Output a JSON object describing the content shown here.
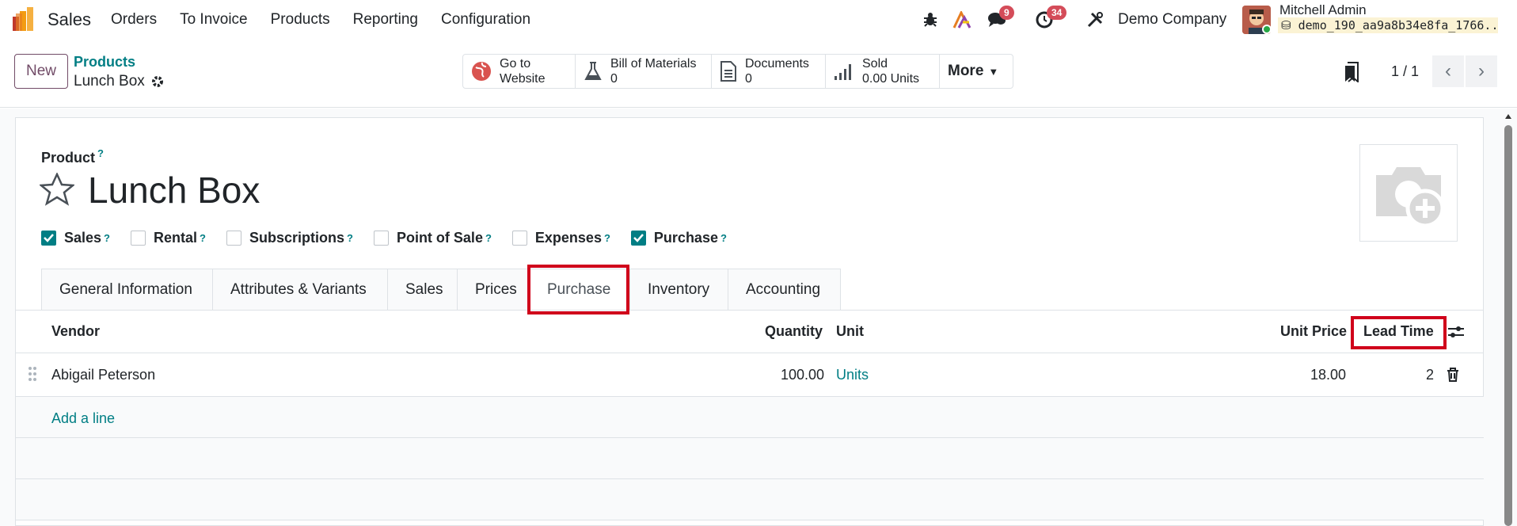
{
  "nav": {
    "app_name": "Sales",
    "menu": [
      "Orders",
      "To Invoice",
      "Products",
      "Reporting",
      "Configuration"
    ],
    "messages_count": "9",
    "activities_count": "34",
    "company": "Demo Company",
    "user_name": "Mitchell Admin",
    "database": "demo_190_aa9a8b34e8fa_1766..."
  },
  "control": {
    "new_label": "New",
    "breadcrumb": "Products",
    "record_name": "Lunch Box",
    "stats": {
      "website_line1": "Go to",
      "website_line2": "Website",
      "bom_label": "Bill of Materials",
      "bom_value": "0",
      "docs_label": "Documents",
      "docs_value": "0",
      "sold_label": "Sold",
      "sold_value": "0.00 Units",
      "more_label": "More"
    },
    "pager": "1 / 1"
  },
  "form": {
    "product_label": "Product",
    "product_name": "Lunch Box",
    "checkboxes": [
      {
        "label": "Sales",
        "checked": true
      },
      {
        "label": "Rental",
        "checked": false
      },
      {
        "label": "Subscriptions",
        "checked": false
      },
      {
        "label": "Point of Sale",
        "checked": false
      },
      {
        "label": "Expenses",
        "checked": false
      },
      {
        "label": "Purchase",
        "checked": true
      }
    ],
    "tabs": [
      "General Information",
      "Attributes & Variants",
      "Sales",
      "Prices",
      "Purchase",
      "Inventory",
      "Accounting"
    ],
    "active_tab": "Purchase"
  },
  "vendors": {
    "headers": {
      "vendor": "Vendor",
      "quantity": "Quantity",
      "unit": "Unit",
      "unit_price": "Unit Price",
      "lead_time": "Lead Time"
    },
    "rows": [
      {
        "vendor": "Abigail Peterson",
        "quantity": "100.00",
        "unit": "Units",
        "unit_price": "18.00",
        "lead_time": "2"
      }
    ],
    "add_line": "Add a line"
  },
  "colors": {
    "accent": "#017e84",
    "brand": "#714b67",
    "highlight": "#d0021b",
    "badge": "#d44c59"
  }
}
